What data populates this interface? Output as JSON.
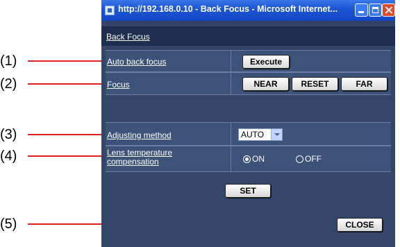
{
  "window": {
    "title": "http://192.168.0.10 - Back Focus - Microsoft Internet...",
    "controls": [
      "minimize-icon",
      "maximize-icon",
      "close-icon"
    ]
  },
  "panel": {
    "heading": "Back Focus",
    "auto_back_focus": {
      "label": "Auto back focus",
      "execute_label": "Execute"
    },
    "focus": {
      "label": "Focus",
      "near_label": "NEAR",
      "reset_label": "RESET",
      "far_label": "FAR"
    },
    "adjusting_method": {
      "label": "Adjusting method",
      "selected": "AUTO"
    },
    "lens_temp": {
      "label_line1": "Lens temperature",
      "label_line2": "compensation",
      "on_label": "ON",
      "off_label": "OFF",
      "selected": "ON"
    },
    "set_label": "SET",
    "close_label": "CLOSE"
  },
  "callouts": [
    "(1)",
    "(2)",
    "(3)",
    "(4)",
    "(5)"
  ],
  "colors": {
    "panel_bg": "#33466a",
    "header_bg": "#1d2e4f",
    "row_bg": "#3c5278",
    "callout_line": "#e0201c",
    "titlebar": "#1c56d6"
  }
}
